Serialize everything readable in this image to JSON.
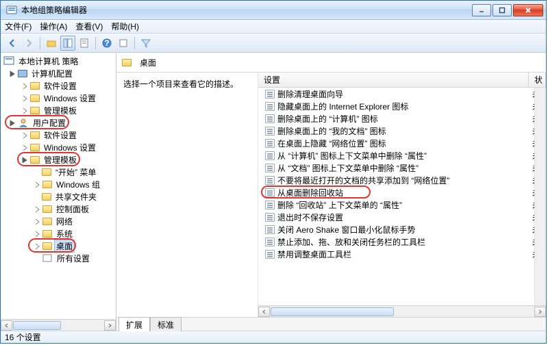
{
  "window": {
    "title": "本地组策略编辑器"
  },
  "menu": {
    "file": "文件(F)",
    "action": "操作(A)",
    "view": "查看(V)",
    "help": "帮助(H)"
  },
  "tree": {
    "root": "本地计算机 策略",
    "computerConfig": "计算机配置",
    "softwareSettings": "软件设置",
    "windowsSettings": "Windows 设置",
    "adminTemplates": "管理模板",
    "userConfig": "用户配置",
    "startMenu": "“开始” 菜单",
    "windowsComp": "Windows 组",
    "sharedFolders": "共享文件夹",
    "controlPanel": "控制面板",
    "network": "网络",
    "system": "系统",
    "desktop": "桌面",
    "allSettings": "所有设置"
  },
  "right": {
    "title": "桌面",
    "desc": "选择一个项目来查看它的描述。",
    "columns": {
      "setting": "设置",
      "state": "状"
    },
    "unknown": "未",
    "items": [
      "删除清理桌面向导",
      "隐藏桌面上的 Internet Explorer 图标",
      "删除桌面上的 “计算机” 图标",
      "删除桌面上的 “我的文档” 图标",
      "在桌面上隐藏 “网络位置” 图标",
      "从 “计算机” 图标上下文菜单中删除 “属性”",
      "从 “文档” 图标上下文菜单中删除 “属性”",
      "不要将最近打开的文档的共享添加到 “网络位置”",
      "从桌面删除回收站",
      "删除 “回收站” 上下文菜单的 “属性”",
      "退出时不保存设置",
      "关闭 Aero Shake 窗口最小化鼠标手势",
      "禁止添加、拖、放和关闭任务栏的工具栏",
      "禁用调整桌面工具栏"
    ],
    "highlightIndex": 8
  },
  "tabs": {
    "extended": "扩展",
    "standard": "标准"
  },
  "status": "16 个设置"
}
